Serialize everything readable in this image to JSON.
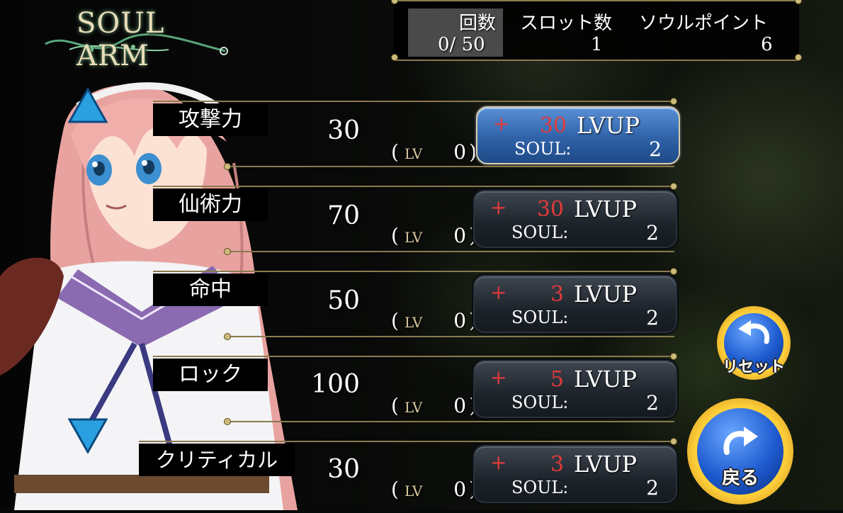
{
  "logo": {
    "title": "SOUL ARM"
  },
  "stats": {
    "count_label": "回数",
    "count_value": "0/ 50",
    "slots_label": "スロット数",
    "slots_value": "1",
    "soul_points_label": "ソウルポイント",
    "soul_points_value": "6"
  },
  "rows": [
    {
      "label": "攻撃力",
      "value": "30",
      "lv_open": "(",
      "lv_label": "LV",
      "lv_value": "0",
      "lv_close": ")",
      "plus": "+",
      "amount": "30",
      "lvup": "LVUP",
      "soul_label": "SOUL:",
      "soul_cost": "2"
    },
    {
      "label": "仙術力",
      "value": "70",
      "lv_open": "(",
      "lv_label": "LV",
      "lv_value": "0",
      "lv_close": ")",
      "plus": "+",
      "amount": "30",
      "lvup": "LVUP",
      "soul_label": "SOUL:",
      "soul_cost": "2"
    },
    {
      "label": "命中",
      "value": "50",
      "lv_open": "(",
      "lv_label": "LV",
      "lv_value": "0",
      "lv_close": ")",
      "plus": "+",
      "amount": "3",
      "lvup": "LVUP",
      "soul_label": "SOUL:",
      "soul_cost": "2"
    },
    {
      "label": "ロック",
      "value": "100",
      "lv_open": "(",
      "lv_label": "LV",
      "lv_value": "0",
      "lv_close": ")",
      "plus": "+",
      "amount": "5",
      "lvup": "LVUP",
      "soul_label": "SOUL:",
      "soul_cost": "2"
    },
    {
      "label": "クリティカル",
      "value": "30",
      "lv_open": "(",
      "lv_label": "LV",
      "lv_value": "0",
      "lv_close": ")",
      "plus": "+",
      "amount": "3",
      "lvup": "LVUP",
      "soul_label": "SOUL:",
      "soul_cost": "2"
    }
  ],
  "buttons": {
    "reset_label": "リセット",
    "back_label": "戻る"
  },
  "icons": {
    "scroll_up": "triangle-up-icon",
    "scroll_down": "triangle-down-icon",
    "reset": "undo-arrow-icon",
    "back": "redo-arrow-icon"
  },
  "colors": {
    "accent_red": "#e23a3a",
    "gold": "#8a7a50",
    "selected_blue": "#2f62a8",
    "button_gold": "#ffcf3a"
  }
}
